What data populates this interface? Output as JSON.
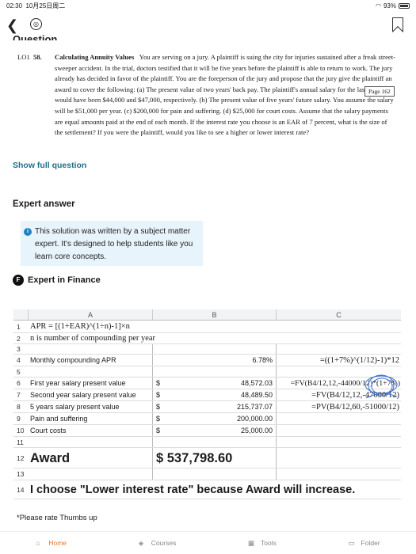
{
  "status": {
    "time": "02:30",
    "date": "10月25日周二",
    "battery": "93%"
  },
  "question": {
    "heading": "Question",
    "code": "LO1",
    "number": "58.",
    "title": "Calculating Annuity Values",
    "body": "You are serving on a jury. A plaintiff is suing the city for injuries sustained after a freak street-sweeper accident. In the trial, doctors testified that it will be five years before the plaintiff is able to return to work. The jury already has decided in favor of the plaintiff. You are the foreperson of the jury and propose that the jury give the plaintiff an award to cover the following: (a) The present value of two years' back pay. The plaintiff's annual salary for the last two years would have been $44,000 and $47,000, respectively. (b) The present value of five years' future salary. You assume the salary will be $51,000 per year. (c) $200,000 for pain and suffering. (d) $25,000 for court costs. Assume that the salary payments are equal amounts paid at the end of each month. If the interest rate you choose is an EAR of 7 percent, what is the size of the settlement? If you were the plaintiff, would you like to see a higher or lower interest rate?",
    "page_ref": "Page 162",
    "show_full": "Show full question"
  },
  "expert": {
    "heading": "Expert answer",
    "notice": "This solution was written by a subject matter expert. It's designed to help students like you learn core concepts.",
    "badge": "F",
    "subject": "Expert in Finance"
  },
  "sheet": {
    "columns": [
      "A",
      "B",
      "C"
    ],
    "r1": "APR  = [(1+EAR)^(1÷n)-1]×n",
    "r2": "n is number of compounding per year",
    "r4a": "Monthly compounding APR",
    "r4b": "6.78%",
    "r4c": "=((1+7%)^(1/12)-1)*12",
    "r6a": "First year salary present value",
    "r6d": "$",
    "r6b": "48,572.03",
    "r6c": "=FV(B4/12,12,-44000/12)*(1+7%)",
    "r7a": "Second year salary present value",
    "r7d": "$",
    "r7b": "48,489.50",
    "r7c": "=FV(B4/12,12,-47000/12)",
    "r8a": "5 years salary present value",
    "r8d": "$",
    "r8b": "215,737.07",
    "r8c": "=PV(B4/12,60,-51000/12)",
    "r9a": "Pain and suffering",
    "r9d": "$",
    "r9b": "200,000.00",
    "r10a": "Court costs",
    "r10d": "$",
    "r10b": "25,000.00",
    "r12a": "Award",
    "r12b": "$  537,798.60",
    "r14": "I choose \"Lower interest rate\" because Award will increase."
  },
  "footer_note": "*Please rate Thumbs up",
  "nav": {
    "home": "Home",
    "courses": "Courses",
    "tools": "Tools",
    "folder": "Folder"
  },
  "colors": {
    "accent": "#e07a2f",
    "link": "#1d6f8a",
    "info": "#1f82c4"
  }
}
